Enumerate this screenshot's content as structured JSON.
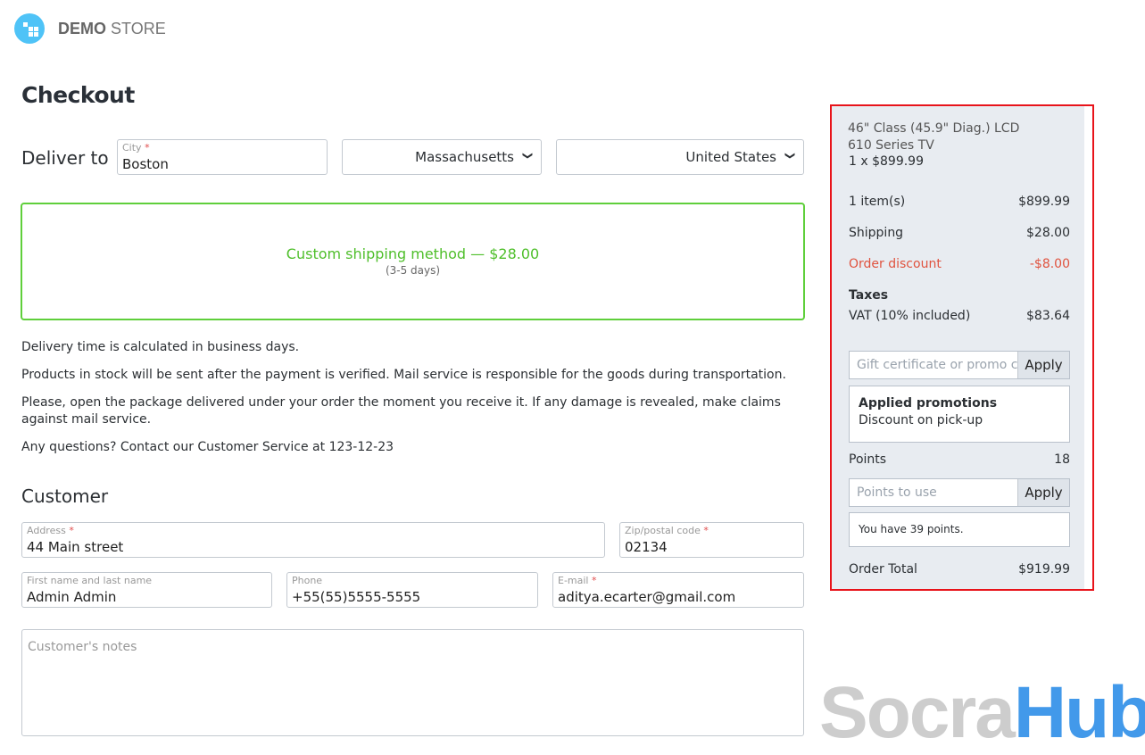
{
  "brand": {
    "bold": "DEMO",
    "light": "STORE"
  },
  "title": "Checkout",
  "deliver": {
    "label": "Deliver to",
    "city_label": "City",
    "city": "Boston",
    "state": "Massachusetts",
    "country": "United States"
  },
  "shipping": {
    "method": "Custom shipping method — $28.00",
    "days": "(3-5 days)"
  },
  "info": [
    "Delivery time is calculated in business days.",
    "Products in stock will be sent after the payment is verified. Mail service is responsible for the goods during transportation.",
    "Please, open the package delivered under your order the moment you receive it. If any damage is revealed, make claims against mail service.",
    "Any questions? Contact our Customer Service at 123-12-23"
  ],
  "customer": {
    "heading": "Customer",
    "address_label": "Address",
    "address": "44 Main street",
    "zip_label": "Zip/postal code",
    "zip": "02134",
    "name_label": "First name and last name",
    "name": "Admin Admin",
    "phone_label": "Phone",
    "phone": "+55(55)5555-5555",
    "email_label": "E-mail",
    "email": "aditya.ecarter@gmail.com",
    "notes_placeholder": "Customer's notes"
  },
  "summary": {
    "product": "46\" Class (45.9\" Diag.) LCD 610 Series TV",
    "qty_price": "1 x $899.99",
    "items_label": "1 item(s)",
    "items_value": "$899.99",
    "shipping_label": "Shipping",
    "shipping_value": "$28.00",
    "discount_label": "Order discount",
    "discount_value": "-$8.00",
    "taxes_label": "Taxes",
    "vat_label": "VAT (10% included)",
    "vat_value": "$83.64",
    "promo_placeholder": "Gift certificate or promo code",
    "apply": "Apply",
    "promos_title": "Applied promotions",
    "promo_item": "Discount on pick-up",
    "points_label": "Points",
    "points_value": "18",
    "points_placeholder": "Points to use",
    "points_info": "You have 39 points.",
    "total_label": "Order Total",
    "total_value": "$919.99"
  },
  "watermark": {
    "a": "Socra",
    "b": "Hub"
  }
}
